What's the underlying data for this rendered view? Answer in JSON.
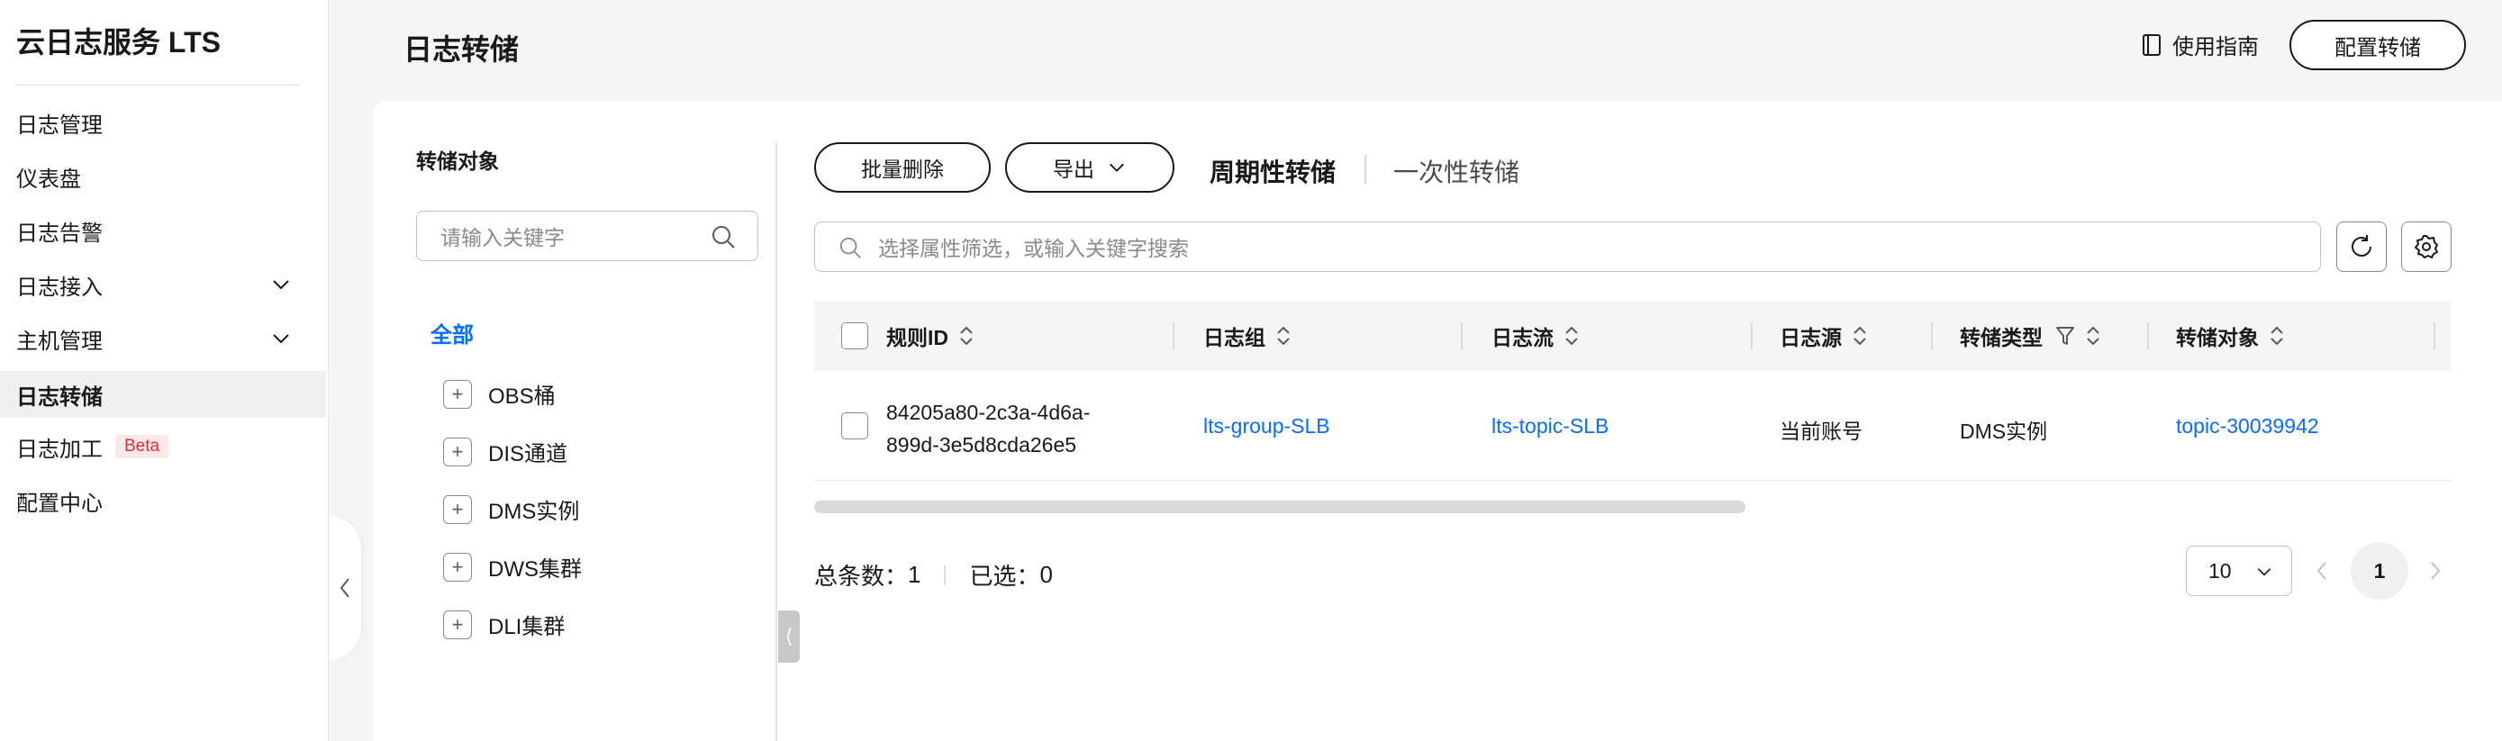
{
  "sidebar": {
    "title": "云日志服务 LTS",
    "items": [
      {
        "label": "日志管理"
      },
      {
        "label": "仪表盘"
      },
      {
        "label": "日志告警"
      },
      {
        "label": "日志接入"
      },
      {
        "label": "主机管理"
      },
      {
        "label": "日志转储"
      },
      {
        "label": "日志加工",
        "badge": "Beta"
      },
      {
        "label": "配置中心"
      }
    ]
  },
  "header": {
    "title": "日志转储",
    "guide_label": "使用指南",
    "config_button": "配置转储"
  },
  "left_panel": {
    "title": "转储对象",
    "search_placeholder": "请输入关键字",
    "all_label": "全部",
    "tree": [
      {
        "label": "OBS桶"
      },
      {
        "label": "DIS通道"
      },
      {
        "label": "DMS实例"
      },
      {
        "label": "DWS集群"
      },
      {
        "label": "DLI集群"
      }
    ]
  },
  "toolbar": {
    "batch_delete": "批量删除",
    "export": "导出",
    "tabs": [
      {
        "label": "周期性转储",
        "active": true
      },
      {
        "label": "一次性转储",
        "active": false
      }
    ],
    "search_placeholder": "选择属性筛选，或输入关键字搜索"
  },
  "table": {
    "columns": [
      "规则ID",
      "日志组",
      "日志流",
      "日志源",
      "转储类型",
      "转储对象"
    ],
    "rows": [
      {
        "rule_id_line1": "84205a80-2c3a-4d6a-",
        "rule_id_line2": "899d-3e5d8cda26e5",
        "log_group": "lts-group-SLB",
        "log_stream": "lts-topic-SLB",
        "log_source": "当前账号",
        "dump_type": "DMS实例",
        "dump_target": "topic-30039942"
      }
    ]
  },
  "footer": {
    "total_label": "总条数：",
    "total_value": "1",
    "selected_label": "已选：",
    "selected_value": "0",
    "page_size": "10",
    "current_page": "1"
  },
  "colors": {
    "link": "#0a6cff",
    "beta_bg": "#fde8e8",
    "beta_text": "#d0333b"
  }
}
